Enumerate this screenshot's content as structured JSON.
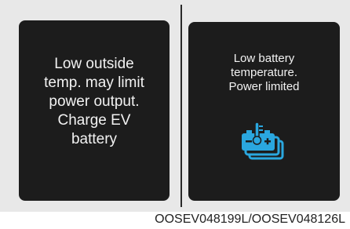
{
  "left_screen": {
    "lines": [
      "Low outside",
      "temp. may limit",
      "power output.",
      "Charge EV",
      "battery"
    ]
  },
  "right_screen": {
    "lines": [
      "Low battery",
      "temperature.",
      "Power limited"
    ],
    "icon": "battery-temperature-icon",
    "icon_color": "#2aa7df"
  },
  "caption": "OOSEV048199L/OOSEV048126L",
  "colors": {
    "screen_bg": "#1c1c1c",
    "panel_bg": "#e8e8e8",
    "text": "#f2f2f2"
  }
}
